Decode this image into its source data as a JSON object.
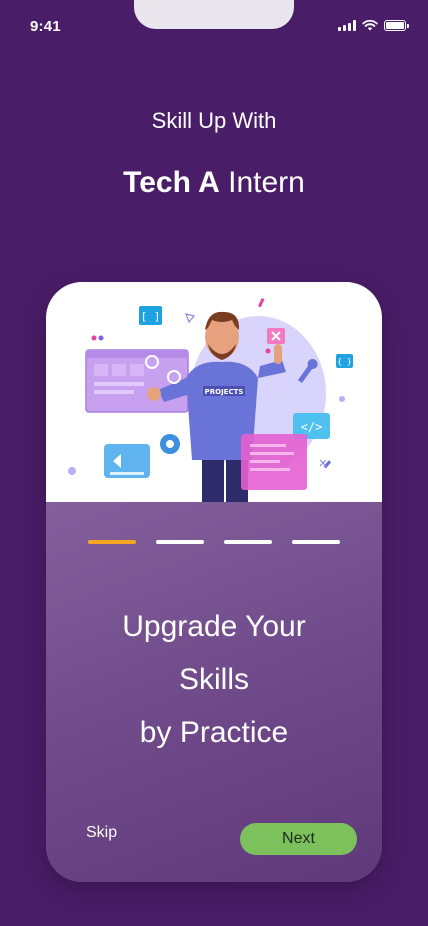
{
  "status_bar": {
    "time": "9:41"
  },
  "header": {
    "line1": "Skill Up With",
    "brand_bold": "Tech A",
    "brand_rest": " Intern"
  },
  "illustration": {
    "shirt_text": "PROJECTS",
    "bracket_glyph": "[ ]",
    "brace_glyph": "{ }",
    "code_glyph": "</>"
  },
  "onboarding": {
    "total_steps": 4,
    "current_step": 1,
    "headline": [
      "Upgrade Your",
      "Skills",
      "by Practice"
    ]
  },
  "actions": {
    "skip_label": "Skip",
    "next_label": "Next"
  },
  "colors": {
    "background": "#4a1d68",
    "active_indicator": "#f5a623",
    "next_button": "#7cc15c"
  }
}
